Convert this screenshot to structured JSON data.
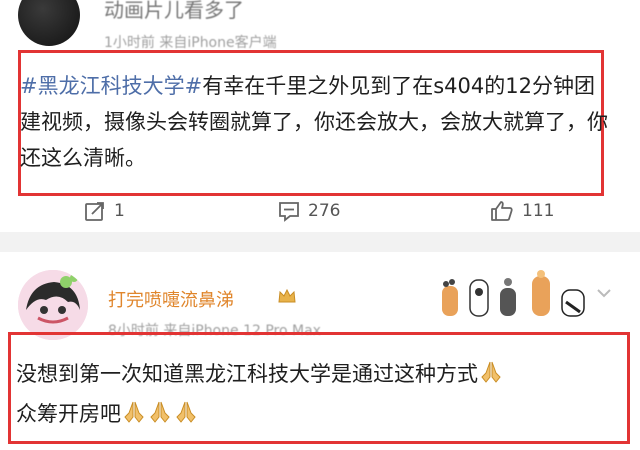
{
  "post1": {
    "top_text": "动画片儿看多了",
    "meta": "1小时前  来自iPhone客户端",
    "hashtag": "#黑龙江科技大学#",
    "body": "有幸在千里之外见到了在s404的12分钟团建视频，摄像头会转圈就算了，你还会放大，会放大就算了，你还这么清晰。",
    "repost_count": "1",
    "comment_count": "276",
    "like_count": "111"
  },
  "post2": {
    "username": "打完喷嚏流鼻涕",
    "meta": "8小时前  来自iPhone 12 Pro Max",
    "body": "没想到第一次知道黑龙江科技大学是通过这种方式",
    "body_line2": "众筹开房吧"
  },
  "icons": [
    "repost-icon",
    "comment-icon",
    "like-icon",
    "crown-icon",
    "pray-emoji-icon",
    "chevron-down-icon",
    "cat-paw-sticker-icon"
  ],
  "colors": {
    "highlight_box": "#e23434",
    "hashtag": "#4e6ea8",
    "username": "#e0862c"
  }
}
